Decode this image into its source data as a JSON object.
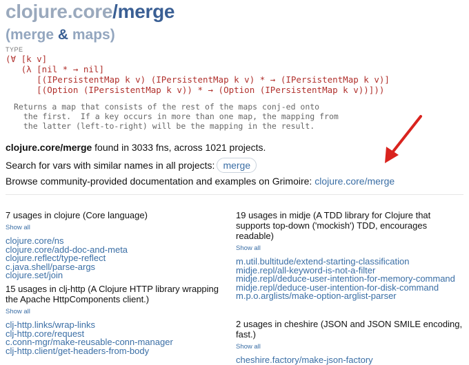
{
  "header": {
    "ns": "clojure.core",
    "sep": "/",
    "fn": "merge",
    "subtitle_open": "(merge",
    "subtitle_amp": " & ",
    "subtitle_close": "maps)",
    "type_label": "TYPE"
  },
  "signature": [
    "(∀ [k v]",
    "   (λ [nil * → nil]",
    "      [(IPersistentMap k v) (IPersistentMap k v) * → (IPersistentMap k v)]",
    "      [(Option (IPersistentMap k v)) * → (Option (IPersistentMap k v))]))"
  ],
  "docstring": [
    "Returns a map that consists of the rest of the maps conj-ed onto",
    "  the first.  If a key occurs in more than one map, the mapping from",
    "  the latter (left-to-right) will be the mapping in the result."
  ],
  "summary": {
    "var": "clojure.core/merge",
    "text": " found in 3033 fns, across 1021 projects."
  },
  "search": {
    "text": "Search for vars with similar names in all projects:",
    "pill": "merge"
  },
  "browse": {
    "text": "Browse community-provided documentation and examples on Grimoire:",
    "link": "clojure.core/merge"
  },
  "groups": [
    {
      "title": "7 usages in clojure (Core language)",
      "show_all": "Show all",
      "uses": [
        "clojure.core/ns",
        "clojure.core/add-doc-and-meta",
        "clojure.reflect/type-reflect",
        "c.java.shell/parse-args",
        "clojure.set/join"
      ]
    },
    {
      "title": "15 usages in clj-http (A Clojure HTTP library wrapping the Apache HttpComponents client.)",
      "show_all": "Show all",
      "uses": [
        "clj-http.links/wrap-links",
        "clj-http.core/request",
        "c.conn-mgr/make-reusable-conn-manager",
        "clj-http.client/get-headers-from-body"
      ]
    },
    {
      "title": "19 usages in midje (A TDD library for Clojure that supports top-down ('mockish') TDD, encourages readable)",
      "show_all": "Show all",
      "uses": [
        "m.util.bultitude/extend-starting-classification",
        "midje.repl/all-keyword-is-not-a-filter",
        "midje.repl/deduce-user-intention-for-memory-command",
        "midje.repl/deduce-user-intention-for-disk-command",
        "m.p.o.arglists/make-option-arglist-parser"
      ]
    },
    {
      "title": "2 usages in cheshire (JSON and JSON SMILE encoding, fast.)",
      "show_all": "Show all",
      "uses": [
        "cheshire.factory/make-json-factory"
      ]
    }
  ],
  "colors": {
    "ns": "#9aa9bd",
    "fn": "#3a5f94",
    "type_sig": "#b0302c",
    "link": "#3a6ea5",
    "arrow": "#d9231e"
  }
}
